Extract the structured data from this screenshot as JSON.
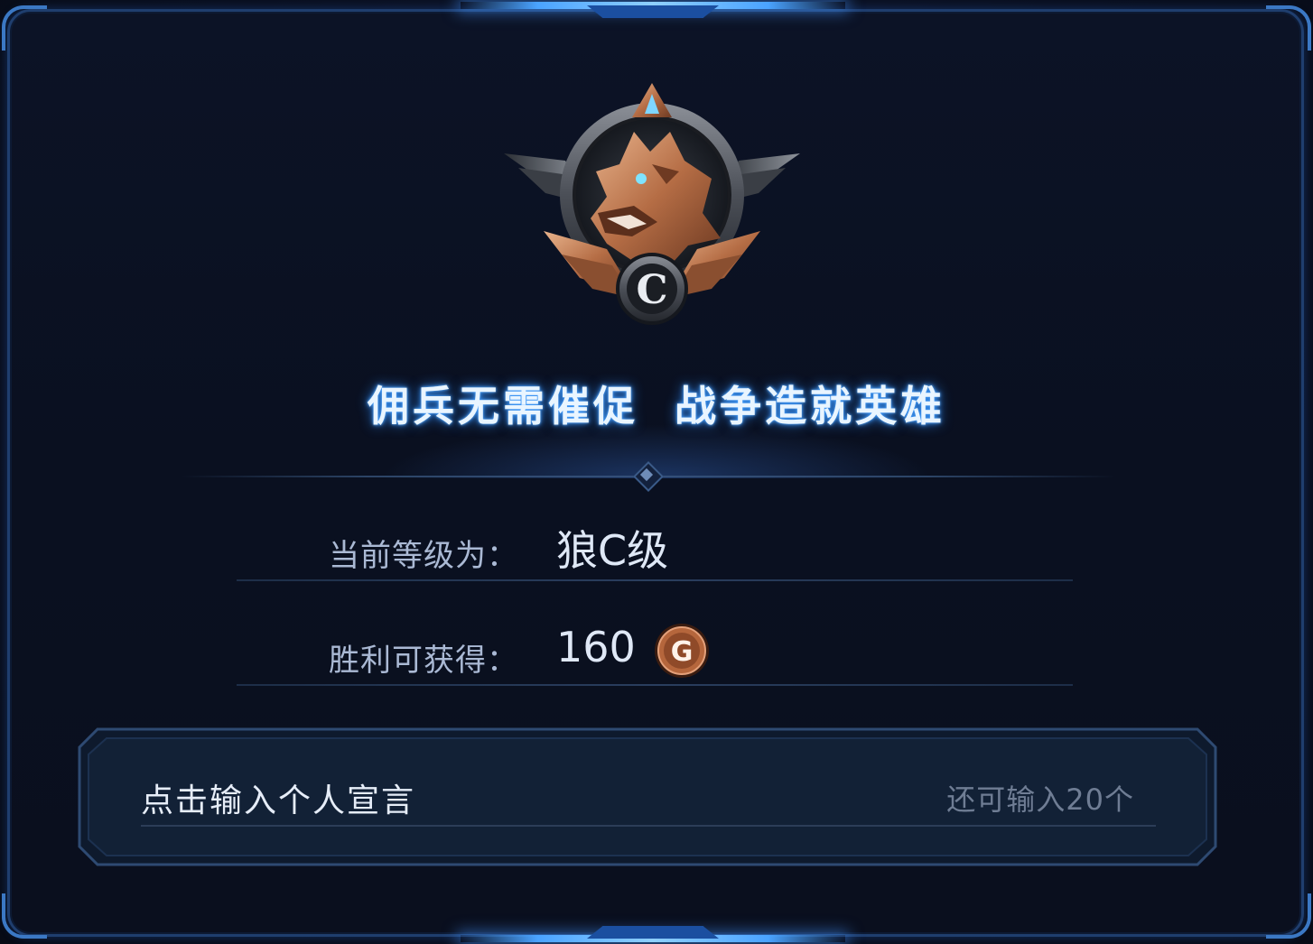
{
  "rank_dialog": {
    "emblem": {
      "icon": "wolf-rank-emblem-icon",
      "letter": "C"
    },
    "motto": "佣兵无需催促  战争造就英雄",
    "current_rank": {
      "label": "当前等级为：",
      "value": "狼C级"
    },
    "win_reward": {
      "label": "胜利可获得：",
      "value": "160",
      "currency_icon": "gold-coin-icon",
      "currency_letter": "G"
    },
    "declaration_input": {
      "placeholder": "点击输入个人宣言",
      "remaining": "还可输入20个"
    }
  },
  "colors": {
    "accent_glow": "#4aa3ff",
    "motto_text": "#e9f5ff",
    "label_text": "#aab9d4",
    "coin_bronze": "#b5663c"
  }
}
